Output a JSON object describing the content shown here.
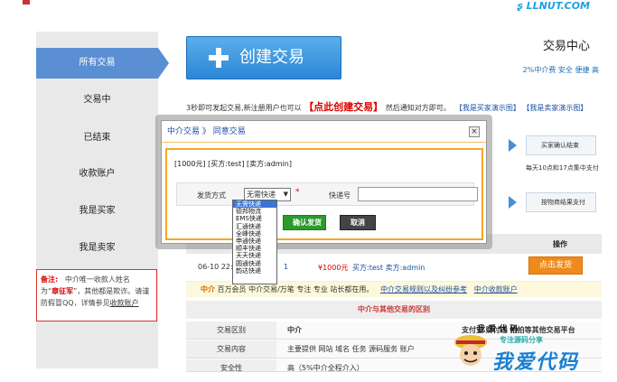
{
  "logo": {
    "text": "ʂ LLNUT.COM"
  },
  "sidebar": {
    "items": [
      {
        "label": "所有交易",
        "active": true
      },
      {
        "label": "交易中",
        "active": false
      },
      {
        "label": "已结束",
        "active": false
      },
      {
        "label": "收款账户",
        "active": false
      },
      {
        "label": "我是买家",
        "active": false
      },
      {
        "label": "我是卖家",
        "active": false
      }
    ],
    "note": {
      "label": "备注:",
      "line1": "中介唯一收款人姓名",
      "prefix": "为“",
      "name": "章征军",
      "line2": "”，其他都是欺诈。请谨",
      "line3a": "防假冒QQ，详情参见",
      "link": "收款账户"
    }
  },
  "header": {
    "create_label": "创建交易",
    "center_title": "交易中心",
    "center_sub": "2%中介费 安全 便捷 高"
  },
  "notice": {
    "before": "3秒即可发起交易,新注册用户也可以",
    "highlight": "【点此创建交易】",
    "after": "然后通知对方即可。",
    "link1": "【我是买家演示图】",
    "link2": "【我是卖家演示图】"
  },
  "flow": {
    "step1": "买家确认结束",
    "step1_note": "每天10点和17点集中支付",
    "step2": "按物商结果支付"
  },
  "modal": {
    "breadcrumb": "中介交易 》 同意交易",
    "close": "×",
    "order_info": "[1000元] [买方:test] [卖方:admin]",
    "ship_method_label": "发货方式",
    "ship_selected": "无需快递",
    "required_mark": "*",
    "tracking_label": "快递号",
    "tracking_value": "",
    "confirm_label": "确认发货",
    "cancel_label": "取消"
  },
  "ship_options": [
    "无需快递",
    "德邦物流",
    "EMS快递",
    "汇通快递",
    "全峰快递",
    "申通快递",
    "顺丰快递",
    "天天快递",
    "圆通快递",
    "韵达快递"
  ],
  "table": {
    "col_op": "操作",
    "row": {
      "date": "06-10 22:",
      "num": "1",
      "amount": "¥1000元",
      "parties": "买方:test 卖方:admin",
      "action": "点击发货"
    }
  },
  "info_strip": {
    "brand": "中介",
    "text": " 百万会员 中介交易/万笔 专注 专业 站长都在用。",
    "link1": "中介交易规则以及纠纷参考",
    "link2": "中介收款账户"
  },
  "compare": {
    "title": "中介与其他交易的区别",
    "header": {
      "label": "交易区别",
      "val": "中介",
      "right": "支付宝 财付通 拍拍等其他交易平台"
    },
    "rows": [
      {
        "label": "交易内容",
        "val": "主要提供 网站 域名 任务 源码服务 账户"
      },
      {
        "label": "安全性",
        "val": "高（5%中介全程介入）"
      }
    ]
  },
  "watermark": {
    "top": "我 爱 代 码",
    "tag": "专注源码分享",
    "big": "我爱代码"
  }
}
